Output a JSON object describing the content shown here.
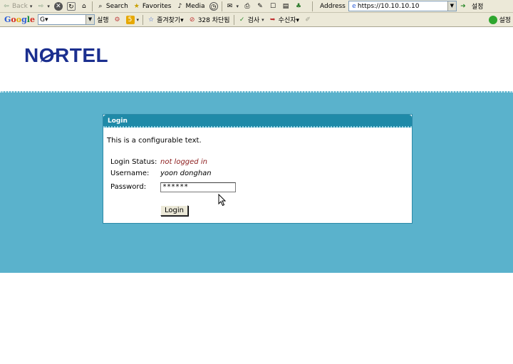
{
  "browser": {
    "toolbar": {
      "back_label": "Back",
      "search_label": "Search",
      "favorites_label": "Favorites",
      "media_label": "Media",
      "address_label": "Address",
      "address_value": "https://10.10.10.10",
      "right_cut_label": "설정"
    },
    "google_bar": {
      "logo_letters": [
        "G",
        "o",
        "o",
        "g",
        "l",
        "e"
      ],
      "search_value": "G▾",
      "run_label": "실행",
      "favorites_label": "즐겨찾기▾",
      "blocked_label": "328 차단됨",
      "check_label": "검사",
      "recipient_label": "수신자▾"
    }
  },
  "page": {
    "logo_text": "NORTEL",
    "login_panel": {
      "title": "Login",
      "intro_text": "This is a configurable text.",
      "status_label": "Login Status:",
      "status_value": "not logged in",
      "username_label": "Username:",
      "username_value": "yoon donghan",
      "password_label": "Password:",
      "password_value": "******",
      "login_button_label": "Login"
    }
  },
  "colors": {
    "band": "#5ab2cc",
    "panel_header": "#1f8aa8",
    "logo": "#1b2f8f",
    "status_text": "#8b1a1a"
  }
}
